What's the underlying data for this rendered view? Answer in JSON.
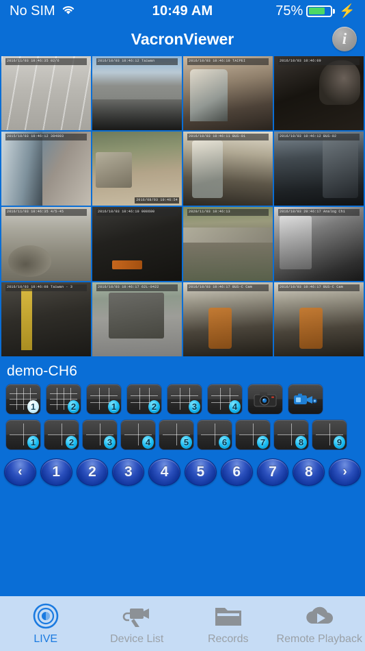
{
  "status_bar": {
    "carrier": "No SIM",
    "wifi_icon": "wifi-icon",
    "time": "10:49 AM",
    "battery_percent": "75%",
    "battery_level": 75,
    "charging_icon": "lightning-bolt-icon"
  },
  "nav": {
    "title": "VacronViewer",
    "info_label": "i",
    "info_icon": "info-icon"
  },
  "video_grid": {
    "columns": 4,
    "rows": 4,
    "selected_index": 5,
    "tiles": [
      {
        "scene": "s-road",
        "timestamp": "2016/11/03 10:46:35  02/6",
        "ts_pos": "top"
      },
      {
        "scene": "s-street",
        "timestamp": "2016/10/03 10:46:12  Taiwan",
        "ts_pos": "top"
      },
      {
        "scene": "s-bus1",
        "timestamp": "2016/10/03 10:46:10  TAIPEI",
        "ts_pos": "top"
      },
      {
        "scene": "s-cabin",
        "timestamp": "2016/10/03 10:46:09",
        "ts_pos": "top"
      },
      {
        "scene": "s-wall",
        "timestamp": "2015/10/03 10:46:12  384003",
        "ts_pos": "top"
      },
      {
        "scene": "s-alley",
        "timestamp": "2016/08/03 10:46:54",
        "ts_pos": "bottom"
      },
      {
        "scene": "s-bus2",
        "timestamp": "2016/10/03 10:46:11  BUS-01",
        "ts_pos": "top"
      },
      {
        "scene": "s-busdark",
        "timestamp": "2016/10/03 10:46:12  BUS-02",
        "ts_pos": "top"
      },
      {
        "scene": "s-dirt",
        "timestamp": "2016/11/03 10:46:35  4/5-45",
        "ts_pos": "top"
      },
      {
        "scene": "s-night",
        "timestamp": "2016/10/03 10:46:10  000600",
        "ts_pos": "top"
      },
      {
        "scene": "s-creek",
        "timestamp": "2020/11/03 10:46:13",
        "ts_pos": "top"
      },
      {
        "scene": "s-bw",
        "timestamp": "2016/10/03 20:46:17  Analog Ch1",
        "ts_pos": "top"
      },
      {
        "scene": "s-depot",
        "timestamp": "2016/10/03 10:46:08  Taiwan - 3",
        "ts_pos": "top"
      },
      {
        "scene": "s-truck",
        "timestamp": "2016/10/03 10:46:17  62L-0422",
        "ts_pos": "top"
      },
      {
        "scene": "s-seats",
        "timestamp": "2016/10/03 10:46:17  BUS-C Cam",
        "ts_pos": "top"
      },
      {
        "scene": "s-seats",
        "timestamp": "2016/10/03 10:46:17  BUS-C Cam",
        "ts_pos": "top"
      }
    ]
  },
  "panel": {
    "device_label": "demo-CH6",
    "layout_row1": [
      {
        "badge": "1",
        "grid": 4,
        "active": true,
        "name": "layout-16ch-page1"
      },
      {
        "badge": "2",
        "grid": 4,
        "active": false,
        "name": "layout-16ch-page2"
      },
      {
        "badge": "1",
        "grid": 3,
        "active": false,
        "name": "layout-9ch-page1"
      },
      {
        "badge": "2",
        "grid": 3,
        "active": false,
        "name": "layout-9ch-page2"
      },
      {
        "badge": "3",
        "grid": 3,
        "active": false,
        "name": "layout-9ch-page3"
      },
      {
        "badge": "4",
        "grid": 3,
        "active": false,
        "name": "layout-9ch-page4"
      }
    ],
    "snapshot_icon": "camera-icon",
    "record_icon": "camcorder-icon",
    "layout_row2": [
      {
        "badge": "1",
        "grid": 2,
        "name": "layout-4ch-page1"
      },
      {
        "badge": "2",
        "grid": 2,
        "name": "layout-4ch-page2"
      },
      {
        "badge": "3",
        "grid": 2,
        "name": "layout-4ch-page3"
      },
      {
        "badge": "4",
        "grid": 2,
        "name": "layout-4ch-page4"
      },
      {
        "badge": "5",
        "grid": 2,
        "name": "layout-4ch-page5"
      },
      {
        "badge": "6",
        "grid": 2,
        "name": "layout-4ch-page6"
      },
      {
        "badge": "7",
        "grid": 2,
        "name": "layout-4ch-page7"
      },
      {
        "badge": "8",
        "grid": 2,
        "name": "layout-4ch-page8"
      },
      {
        "badge": "9",
        "grid": 2,
        "name": "layout-4ch-page9"
      }
    ]
  },
  "pager": {
    "prev_label": "‹",
    "next_label": "›",
    "pages": [
      "1",
      "2",
      "3",
      "4",
      "5",
      "6",
      "7",
      "8"
    ]
  },
  "tabbar": {
    "tabs": [
      {
        "label": "LIVE",
        "icon": "live-eye-icon",
        "active": true
      },
      {
        "label": "Device List",
        "icon": "video-camera-icon",
        "active": false
      },
      {
        "label": "Records",
        "icon": "folder-icon",
        "active": false
      },
      {
        "label": "Remote Playback",
        "icon": "cloud-play-icon",
        "active": false
      }
    ]
  },
  "colors": {
    "brand_blue": "#0a6ed6",
    "selection_yellow": "#ffe400",
    "tabbar_background": "#c6dcf5",
    "tab_active": "#1a7ae0",
    "tab_inactive": "#9aa0a6",
    "battery_green": "#4cd964",
    "badge_cyan": "#16b9f0"
  }
}
